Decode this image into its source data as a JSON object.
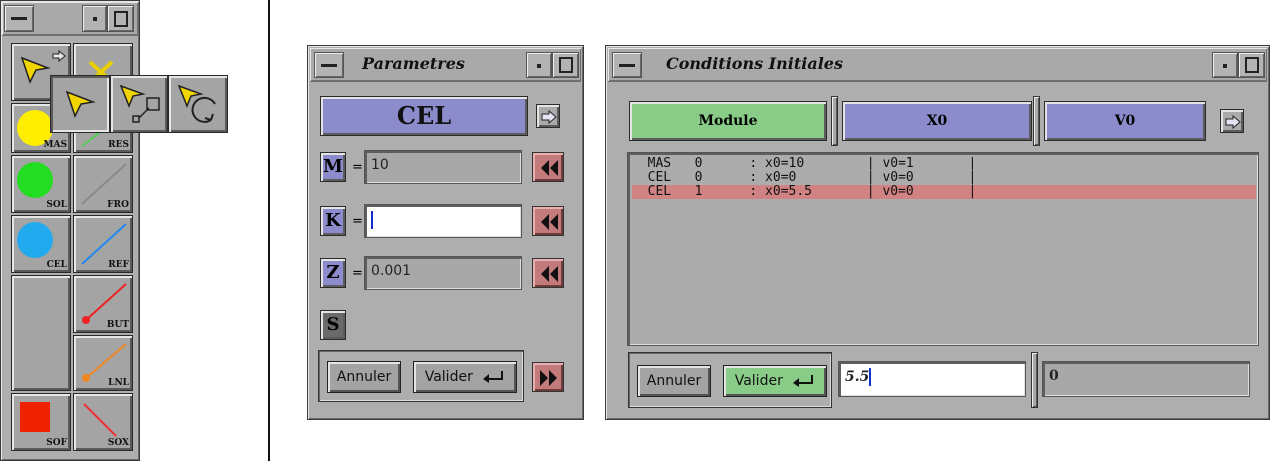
{
  "palette": {
    "tools": [
      {
        "label": "MAS",
        "color": "#ffee00",
        "kind": "circle"
      },
      {
        "label": "RES",
        "color": "#55cc55",
        "kind": "line"
      },
      {
        "label": "SOL",
        "color": "#22dd22",
        "kind": "circle"
      },
      {
        "label": "FRO",
        "color": "#8a8a8a",
        "kind": "line"
      },
      {
        "label": "CEL",
        "color": "#22aaee",
        "kind": "circle"
      },
      {
        "label": "REF",
        "color": "#2288ee",
        "kind": "line"
      },
      {
        "label": "BUT",
        "color": "#ee2222",
        "kind": "line-dot"
      },
      {
        "label": "LNL",
        "color": "#ee8822",
        "kind": "line-dot"
      },
      {
        "label": "SOF",
        "color": "#ee2200",
        "kind": "square"
      },
      {
        "label": "SOX",
        "color": "#ee3333",
        "kind": "line"
      }
    ]
  },
  "parametres": {
    "title": "Parametres",
    "element": "CEL",
    "params": [
      {
        "name": "M",
        "eq": "=",
        "value": "10"
      },
      {
        "name": "K",
        "eq": "=",
        "value": ""
      },
      {
        "name": "Z",
        "eq": "=",
        "value": "0.001"
      }
    ],
    "s_label": "S",
    "cancel_label": "Annuler",
    "validate_label": "Valider"
  },
  "conditions": {
    "title": "Conditions Initiales",
    "columns": [
      "Module",
      "X0",
      "V0"
    ],
    "rows": [
      {
        "text": "  MAS   0      : x0=10        | v0=1       |"
      },
      {
        "text": "  CEL   0      : x0=0         | v0=0       |"
      },
      {
        "text": "  CEL   1      : x0=5.5       | v0=0       |"
      }
    ],
    "cancel_label": "Annuler",
    "validate_label": "Valider",
    "x0_input": "5.5",
    "v0_input": "0"
  },
  "colors": {
    "module_header": "#88cc88",
    "column_header": "#8c8ccc",
    "selected_row": "#d18282",
    "param_label": "#8c8ccc"
  }
}
